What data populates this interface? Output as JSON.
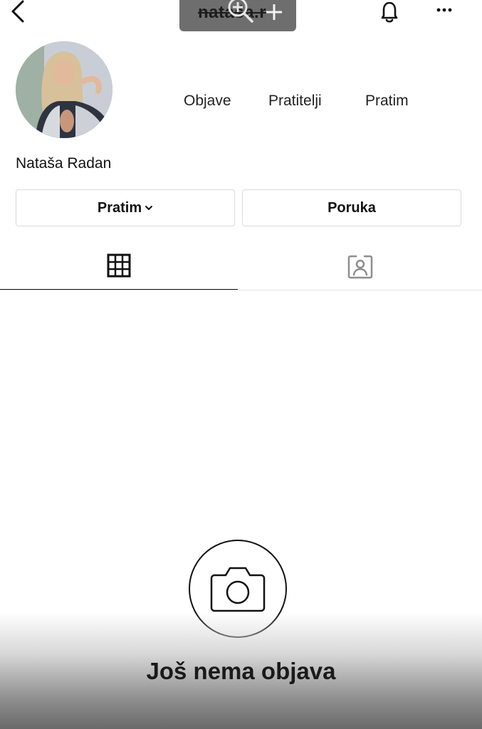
{
  "header": {
    "username": "nataša.r",
    "back_icon": "chevron-left-icon",
    "notification_icon": "bell-icon",
    "more_icon": "more-horizontal-icon",
    "overlay_icons": [
      "zoom-in-icon",
      "plus-icon"
    ]
  },
  "profile": {
    "display_name": "Nataša Radan",
    "stats": {
      "posts_label": "Objave",
      "followers_label": "Pratitelji",
      "following_label": "Pratim"
    }
  },
  "actions": {
    "follow_label": "Pratim",
    "message_label": "Poruka"
  },
  "tabs": {
    "grid_icon": "grid-icon",
    "tagged_icon": "tagged-person-icon"
  },
  "empty_state": {
    "icon": "camera-icon",
    "title": "Još nema objava"
  }
}
